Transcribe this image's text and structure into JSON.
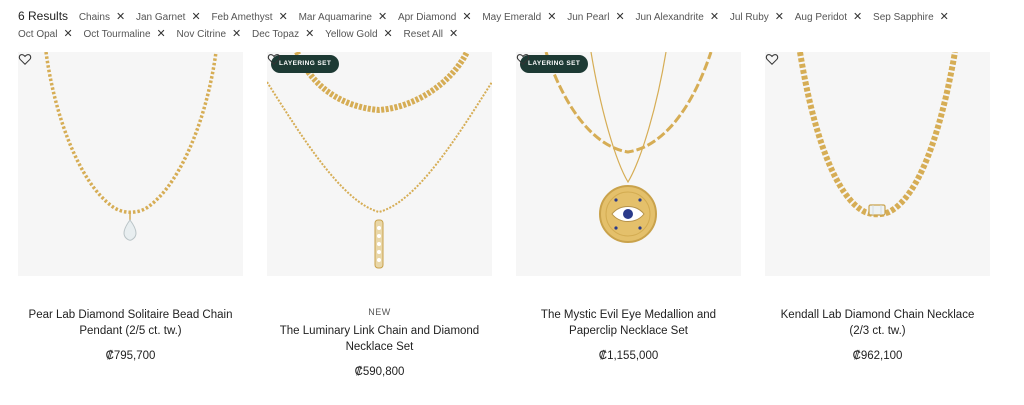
{
  "results": {
    "count": "6 Results"
  },
  "filters": [
    "Chains",
    "Jan Garnet",
    "Feb Amethyst",
    "Mar Aquamarine",
    "Apr Diamond",
    "May Emerald",
    "Jun Pearl",
    "Jun Alexandrite",
    "Jul Ruby",
    "Aug Peridot",
    "Sep Sapphire",
    "Oct Opal",
    "Oct Tourmaline",
    "Nov Citrine",
    "Dec Topaz",
    "Yellow Gold"
  ],
  "reset_label": "Reset All",
  "colors": {
    "gold": "#d6ad55",
    "badge_bg": "#1d3a34",
    "image_bg": "#f6f6f6"
  },
  "products": [
    {
      "title": "Pear Lab Diamond Solitaire Bead Chain Pendant (2/5 ct. tw.)",
      "price": "₡795,700",
      "badge": "",
      "tag": ""
    },
    {
      "title": "The Luminary Link Chain and Diamond Necklace Set",
      "price": "₡590,800",
      "badge": "LAYERING SET",
      "tag": "NEW"
    },
    {
      "title": "The Mystic Evil Eye Medallion and Paperclip Necklace Set",
      "price": "₡1,155,000",
      "badge": "LAYERING SET",
      "tag": ""
    },
    {
      "title": "Kendall Lab Diamond Chain Necklace (2/3 ct. tw.)",
      "price": "₡962,100",
      "badge": "",
      "tag": ""
    }
  ]
}
